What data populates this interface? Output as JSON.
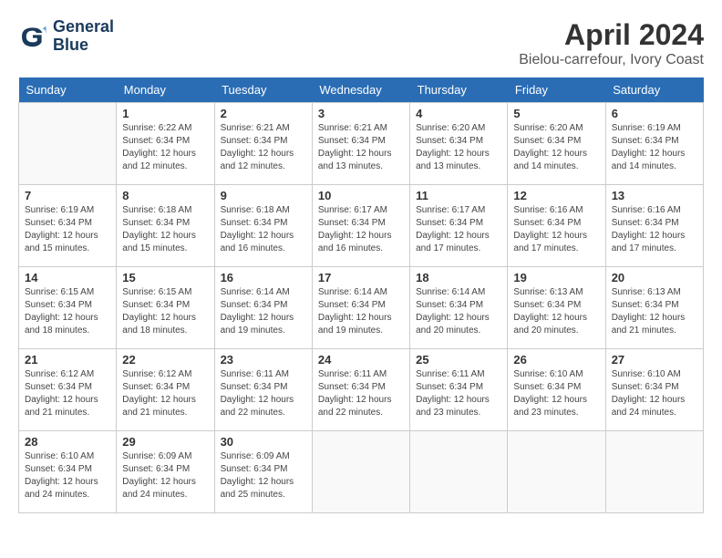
{
  "logo": {
    "line1": "General",
    "line2": "Blue"
  },
  "title": "April 2024",
  "location": "Bielou-carrefour, Ivory Coast",
  "days_of_week": [
    "Sunday",
    "Monday",
    "Tuesday",
    "Wednesday",
    "Thursday",
    "Friday",
    "Saturday"
  ],
  "weeks": [
    [
      {
        "day": "",
        "sunrise": "",
        "sunset": "",
        "daylight": ""
      },
      {
        "day": "1",
        "sunrise": "Sunrise: 6:22 AM",
        "sunset": "Sunset: 6:34 PM",
        "daylight": "Daylight: 12 hours and 12 minutes."
      },
      {
        "day": "2",
        "sunrise": "Sunrise: 6:21 AM",
        "sunset": "Sunset: 6:34 PM",
        "daylight": "Daylight: 12 hours and 12 minutes."
      },
      {
        "day": "3",
        "sunrise": "Sunrise: 6:21 AM",
        "sunset": "Sunset: 6:34 PM",
        "daylight": "Daylight: 12 hours and 13 minutes."
      },
      {
        "day": "4",
        "sunrise": "Sunrise: 6:20 AM",
        "sunset": "Sunset: 6:34 PM",
        "daylight": "Daylight: 12 hours and 13 minutes."
      },
      {
        "day": "5",
        "sunrise": "Sunrise: 6:20 AM",
        "sunset": "Sunset: 6:34 PM",
        "daylight": "Daylight: 12 hours and 14 minutes."
      },
      {
        "day": "6",
        "sunrise": "Sunrise: 6:19 AM",
        "sunset": "Sunset: 6:34 PM",
        "daylight": "Daylight: 12 hours and 14 minutes."
      }
    ],
    [
      {
        "day": "7",
        "sunrise": "Sunrise: 6:19 AM",
        "sunset": "Sunset: 6:34 PM",
        "daylight": "Daylight: 12 hours and 15 minutes."
      },
      {
        "day": "8",
        "sunrise": "Sunrise: 6:18 AM",
        "sunset": "Sunset: 6:34 PM",
        "daylight": "Daylight: 12 hours and 15 minutes."
      },
      {
        "day": "9",
        "sunrise": "Sunrise: 6:18 AM",
        "sunset": "Sunset: 6:34 PM",
        "daylight": "Daylight: 12 hours and 16 minutes."
      },
      {
        "day": "10",
        "sunrise": "Sunrise: 6:17 AM",
        "sunset": "Sunset: 6:34 PM",
        "daylight": "Daylight: 12 hours and 16 minutes."
      },
      {
        "day": "11",
        "sunrise": "Sunrise: 6:17 AM",
        "sunset": "Sunset: 6:34 PM",
        "daylight": "Daylight: 12 hours and 17 minutes."
      },
      {
        "day": "12",
        "sunrise": "Sunrise: 6:16 AM",
        "sunset": "Sunset: 6:34 PM",
        "daylight": "Daylight: 12 hours and 17 minutes."
      },
      {
        "day": "13",
        "sunrise": "Sunrise: 6:16 AM",
        "sunset": "Sunset: 6:34 PM",
        "daylight": "Daylight: 12 hours and 17 minutes."
      }
    ],
    [
      {
        "day": "14",
        "sunrise": "Sunrise: 6:15 AM",
        "sunset": "Sunset: 6:34 PM",
        "daylight": "Daylight: 12 hours and 18 minutes."
      },
      {
        "day": "15",
        "sunrise": "Sunrise: 6:15 AM",
        "sunset": "Sunset: 6:34 PM",
        "daylight": "Daylight: 12 hours and 18 minutes."
      },
      {
        "day": "16",
        "sunrise": "Sunrise: 6:14 AM",
        "sunset": "Sunset: 6:34 PM",
        "daylight": "Daylight: 12 hours and 19 minutes."
      },
      {
        "day": "17",
        "sunrise": "Sunrise: 6:14 AM",
        "sunset": "Sunset: 6:34 PM",
        "daylight": "Daylight: 12 hours and 19 minutes."
      },
      {
        "day": "18",
        "sunrise": "Sunrise: 6:14 AM",
        "sunset": "Sunset: 6:34 PM",
        "daylight": "Daylight: 12 hours and 20 minutes."
      },
      {
        "day": "19",
        "sunrise": "Sunrise: 6:13 AM",
        "sunset": "Sunset: 6:34 PM",
        "daylight": "Daylight: 12 hours and 20 minutes."
      },
      {
        "day": "20",
        "sunrise": "Sunrise: 6:13 AM",
        "sunset": "Sunset: 6:34 PM",
        "daylight": "Daylight: 12 hours and 21 minutes."
      }
    ],
    [
      {
        "day": "21",
        "sunrise": "Sunrise: 6:12 AM",
        "sunset": "Sunset: 6:34 PM",
        "daylight": "Daylight: 12 hours and 21 minutes."
      },
      {
        "day": "22",
        "sunrise": "Sunrise: 6:12 AM",
        "sunset": "Sunset: 6:34 PM",
        "daylight": "Daylight: 12 hours and 21 minutes."
      },
      {
        "day": "23",
        "sunrise": "Sunrise: 6:11 AM",
        "sunset": "Sunset: 6:34 PM",
        "daylight": "Daylight: 12 hours and 22 minutes."
      },
      {
        "day": "24",
        "sunrise": "Sunrise: 6:11 AM",
        "sunset": "Sunset: 6:34 PM",
        "daylight": "Daylight: 12 hours and 22 minutes."
      },
      {
        "day": "25",
        "sunrise": "Sunrise: 6:11 AM",
        "sunset": "Sunset: 6:34 PM",
        "daylight": "Daylight: 12 hours and 23 minutes."
      },
      {
        "day": "26",
        "sunrise": "Sunrise: 6:10 AM",
        "sunset": "Sunset: 6:34 PM",
        "daylight": "Daylight: 12 hours and 23 minutes."
      },
      {
        "day": "27",
        "sunrise": "Sunrise: 6:10 AM",
        "sunset": "Sunset: 6:34 PM",
        "daylight": "Daylight: 12 hours and 24 minutes."
      }
    ],
    [
      {
        "day": "28",
        "sunrise": "Sunrise: 6:10 AM",
        "sunset": "Sunset: 6:34 PM",
        "daylight": "Daylight: 12 hours and 24 minutes."
      },
      {
        "day": "29",
        "sunrise": "Sunrise: 6:09 AM",
        "sunset": "Sunset: 6:34 PM",
        "daylight": "Daylight: 12 hours and 24 minutes."
      },
      {
        "day": "30",
        "sunrise": "Sunrise: 6:09 AM",
        "sunset": "Sunset: 6:34 PM",
        "daylight": "Daylight: 12 hours and 25 minutes."
      },
      {
        "day": "",
        "sunrise": "",
        "sunset": "",
        "daylight": ""
      },
      {
        "day": "",
        "sunrise": "",
        "sunset": "",
        "daylight": ""
      },
      {
        "day": "",
        "sunrise": "",
        "sunset": "",
        "daylight": ""
      },
      {
        "day": "",
        "sunrise": "",
        "sunset": "",
        "daylight": ""
      }
    ]
  ]
}
